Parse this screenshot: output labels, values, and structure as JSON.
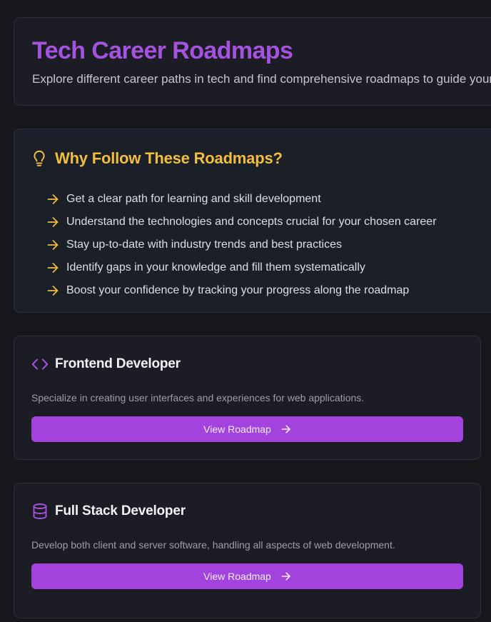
{
  "hero": {
    "title": "Tech Career Roadmaps",
    "subtitle": "Explore different career paths in tech and find comprehensive roadmaps to guide your journey"
  },
  "why": {
    "icon": "lightbulb-icon",
    "title": "Why Follow These Roadmaps?",
    "items": [
      "Get a clear path for learning and skill development",
      "Understand the technologies and concepts crucial for your chosen career",
      "Stay up-to-date with industry trends and best practices",
      "Identify gaps in your knowledge and fill them systematically",
      "Boost your confidence by tracking your progress along the roadmap"
    ]
  },
  "roles": [
    {
      "icon": "code-icon",
      "title": "Frontend Developer",
      "description": "Specialize in creating user interfaces and experiences for web applications.",
      "button_label": "View Roadmap"
    },
    {
      "icon": "database-icon",
      "title": "Full Stack Developer",
      "description": "Develop both client and server software, handling all aspects of web development.",
      "button_label": "View Roadmap"
    }
  ],
  "colors": {
    "accent": "#a143dc",
    "title_purple": "#a552e1",
    "highlight_yellow": "#f2be3b",
    "background": "#16171b"
  }
}
